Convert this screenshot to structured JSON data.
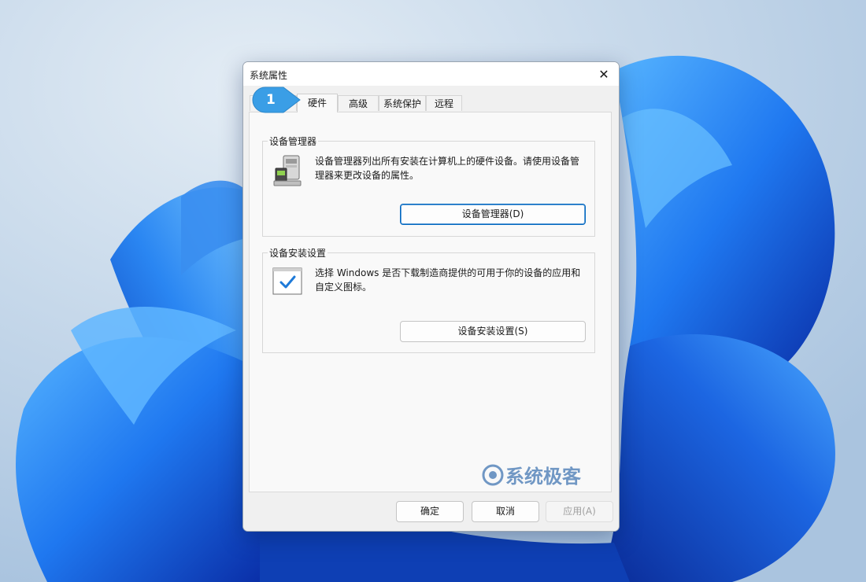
{
  "dialog": {
    "title": "系统属性",
    "close_label": "✕",
    "tabs": [
      {
        "label": ""
      },
      {
        "label": "硬件"
      },
      {
        "label": "高级"
      },
      {
        "label": "系统保护"
      },
      {
        "label": "远程"
      }
    ],
    "active_tab": "硬件",
    "device_manager": {
      "group_title": "设备管理器",
      "description": "设备管理器列出所有安装在计算机上的硬件设备。请使用设备管理器来更改设备的属性。",
      "button_label": "设备管理器(D)"
    },
    "device_install": {
      "group_title": "设备安装设置",
      "description": "选择 Windows 是否下载制造商提供的可用于你的设备的应用和自定义图标。",
      "button_label": "设备安装设置(S)"
    },
    "footer": {
      "ok_label": "确定",
      "cancel_label": "取消",
      "apply_label": "应用(A)"
    }
  },
  "callout": {
    "number": "1",
    "color": "#3a9ee6"
  },
  "watermark": {
    "text": "系统极客"
  },
  "colors": {
    "accent": "#0067c0",
    "wallpaper_blue": "#1f6fe0"
  }
}
